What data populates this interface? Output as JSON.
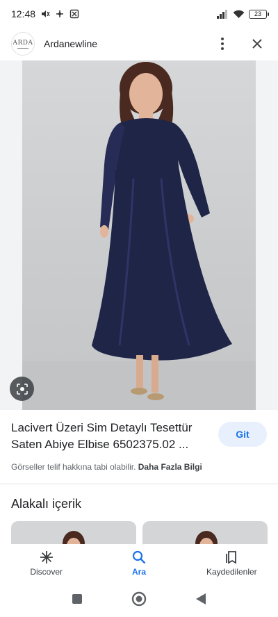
{
  "status": {
    "time": "12:48",
    "battery": "23"
  },
  "header": {
    "site_name": "Ardanewline",
    "logo_text": "ARDA"
  },
  "result": {
    "title": "Lacivert Üzeri Sim Detaylı Tesettür Saten Abiye Elbise 6502375.02 ...",
    "visit_label": "Git",
    "copyright_text": "Görseller telif hakkına tabi olabilir.",
    "more_info_label": "Daha Fazla Bilgi"
  },
  "related": {
    "title": "Alakalı içerik"
  },
  "bottom_nav": [
    {
      "label": "Discover",
      "icon": "asterisk-icon"
    },
    {
      "label": "Ara",
      "icon": "search-icon"
    },
    {
      "label": "Kaydedilenler",
      "icon": "collections-icon"
    }
  ],
  "colors": {
    "accent": "#1a73e8",
    "dress": "#1f2547",
    "background": "#ffffff"
  }
}
